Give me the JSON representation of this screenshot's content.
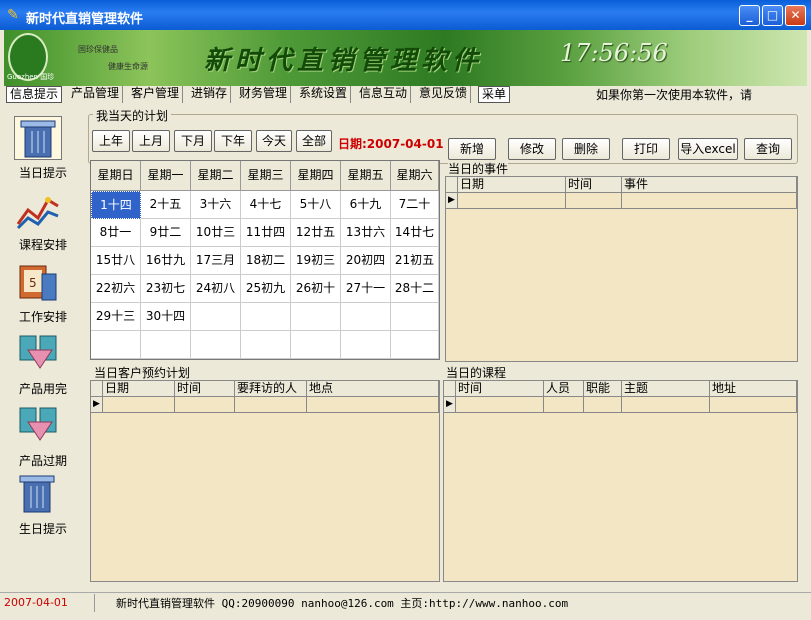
{
  "window": {
    "title": "新时代直销管理软件"
  },
  "banner": {
    "title": "新时代直销管理软件",
    "time": "17:56:56",
    "logo_caption": "Guozhen 国珍",
    "slogan1": "国珍保健品",
    "slogan2": "健康生命源"
  },
  "menu": {
    "items": [
      "信息提示",
      "产品管理",
      "客户管理",
      "进销存",
      "财务管理",
      "系统设置",
      "信息互动",
      "意见反馈",
      "采单"
    ],
    "marquee": "如果你第一次使用本软件，请"
  },
  "sidebar": {
    "items": [
      {
        "label": "当日提示",
        "icon": "trash-bin-icon"
      },
      {
        "label": "课程安排",
        "icon": "chart-icon"
      },
      {
        "label": "工作安排",
        "icon": "calendar-icon"
      },
      {
        "label": "产品用完",
        "icon": "box-icon"
      },
      {
        "label": "产品过期",
        "icon": "box-icon"
      },
      {
        "label": "生日提示",
        "icon": "trash-bin-icon"
      }
    ]
  },
  "plan": {
    "title": "我当天的计划",
    "buttons": [
      "上年",
      "上月",
      "下月",
      "下年",
      "今天",
      "全部"
    ],
    "date_label": "日期:2007-04-01"
  },
  "toolbar": {
    "buttons": [
      "新增",
      "修改",
      "删除",
      "打印",
      "导入excel",
      "查询"
    ]
  },
  "calendar": {
    "weekdays": [
      "星期日",
      "星期一",
      "星期二",
      "星期三",
      "星期四",
      "星期五",
      "星期六"
    ],
    "weeks": [
      [
        "1十四",
        "2十五",
        "3十六",
        "4十七",
        "5十八",
        "6十九",
        "7二十"
      ],
      [
        "8廿一",
        "9廿二",
        "10廿三",
        "11廿四",
        "12廿五",
        "13廿六",
        "14廿七"
      ],
      [
        "15廿八",
        "16廿九",
        "17三月",
        "18初二",
        "19初三",
        "20初四",
        "21初五"
      ],
      [
        "22初六",
        "23初七",
        "24初八",
        "25初九",
        "26初十",
        "27十一",
        "28十二"
      ],
      [
        "29十三",
        "30十四",
        "",
        "",
        "",
        "",
        ""
      ],
      [
        "",
        "",
        "",
        "",
        "",
        "",
        ""
      ]
    ]
  },
  "events": {
    "title": "当日的事件",
    "columns": [
      "日期",
      "时间",
      "事件"
    ]
  },
  "appointments": {
    "title": "当日客户预约计划",
    "columns": [
      "日期",
      "时间",
      "要拜访的人",
      "地点"
    ]
  },
  "courses": {
    "title": "当日的课程",
    "columns": [
      "时间",
      "人员",
      "职能",
      "主题",
      "地址"
    ]
  },
  "status": {
    "date": "2007-04-01",
    "info": "新时代直销管理软件 QQ:20900090 nanhoo@126.com 主页:http://www.nanhoo.com"
  }
}
